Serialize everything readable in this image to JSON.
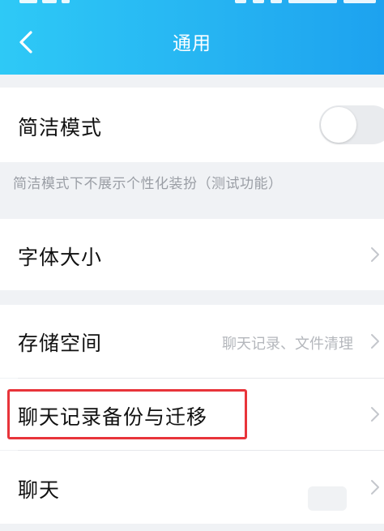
{
  "header": {
    "title": "通用",
    "back_icon": "chevron-left-icon",
    "gradient": [
      "#2ec9f6",
      "#1da2ef"
    ]
  },
  "simple_mode": {
    "label": "简洁模式",
    "toggle_on": false,
    "hint": "简洁模式下不展示个性化装扮（测试功能）"
  },
  "font_size": {
    "label": "字体大小"
  },
  "storage": {
    "label": "存储空间",
    "value": "聊天记录、文件清理"
  },
  "chat_backup": {
    "label": "聊天记录备份与迁移",
    "highlight_color": "#e8343a"
  },
  "chat": {
    "label": "聊天"
  }
}
